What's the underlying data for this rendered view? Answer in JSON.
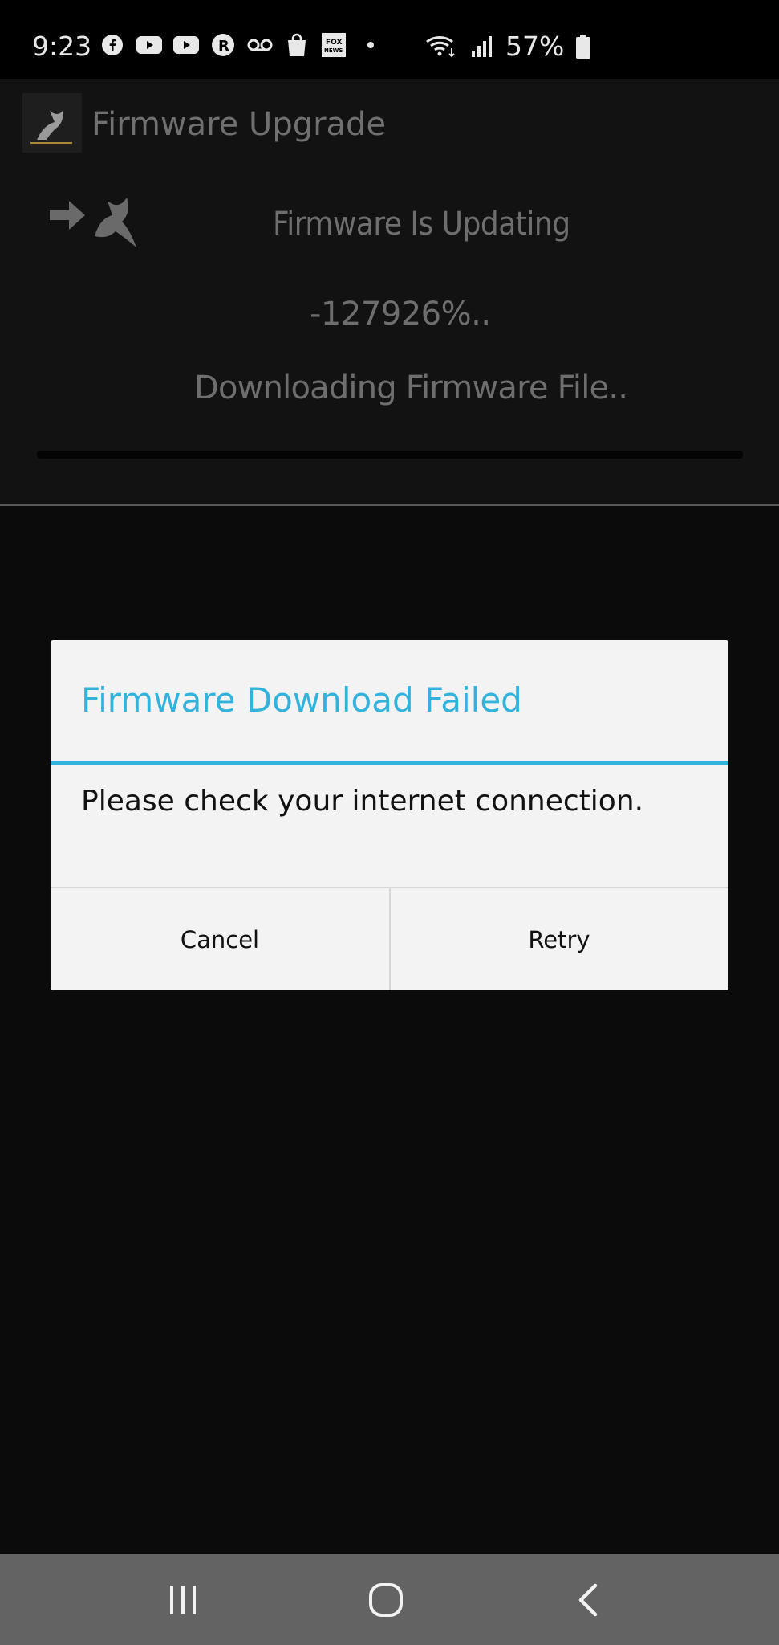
{
  "status_bar": {
    "time": "9:23",
    "battery_percent": "57%",
    "notification_icons": [
      "facebook-icon",
      "youtube-icon",
      "youtube-icon",
      "r-app-icon",
      "voicemail-icon",
      "shopping-bag-icon",
      "fox-news-icon",
      "more-dot-icon"
    ],
    "system_icons": [
      "wifi-icon",
      "signal-icon",
      "battery-icon"
    ]
  },
  "app_bar": {
    "title": "Firmware Upgrade",
    "logo_icon": "bird-logo-icon"
  },
  "update_panel": {
    "title": "Firmware Is Updating",
    "progress_text": "-127926%..",
    "status_text": "Downloading Firmware File..",
    "progress_fraction": 0
  },
  "dialog": {
    "title": "Firmware Download Failed",
    "message": "Please check your internet connection.",
    "cancel_label": "Cancel",
    "retry_label": "Retry"
  },
  "nav_bar": {
    "icons": [
      "recent-apps-icon",
      "home-icon",
      "back-icon"
    ]
  },
  "colors": {
    "accent": "#33b3db",
    "background": "#0b0b0b",
    "dialog_bg": "#f3f3f3",
    "nav_bg": "#636363"
  }
}
